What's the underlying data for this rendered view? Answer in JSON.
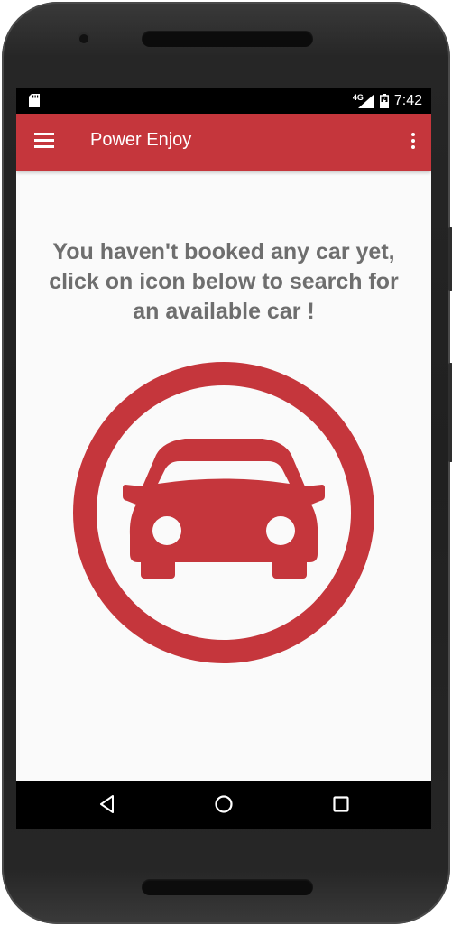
{
  "status_bar": {
    "network_type": "4G",
    "time": "7:42",
    "icons": [
      "sd-card-icon",
      "signal-icon",
      "battery-icon"
    ]
  },
  "app_bar": {
    "title": "Power Enjoy",
    "color": "#c5363c",
    "icons": [
      "menu-icon",
      "overflow-menu-icon"
    ]
  },
  "main": {
    "message": "You haven't booked any car yet,\nclick on icon below to search for\nan available car !",
    "message_color": "#6e6e6e",
    "search_car_icon": "car-icon",
    "accent_color": "#c5363c"
  },
  "nav_bar": {
    "buttons": [
      "back-icon",
      "home-icon",
      "recents-icon"
    ]
  }
}
